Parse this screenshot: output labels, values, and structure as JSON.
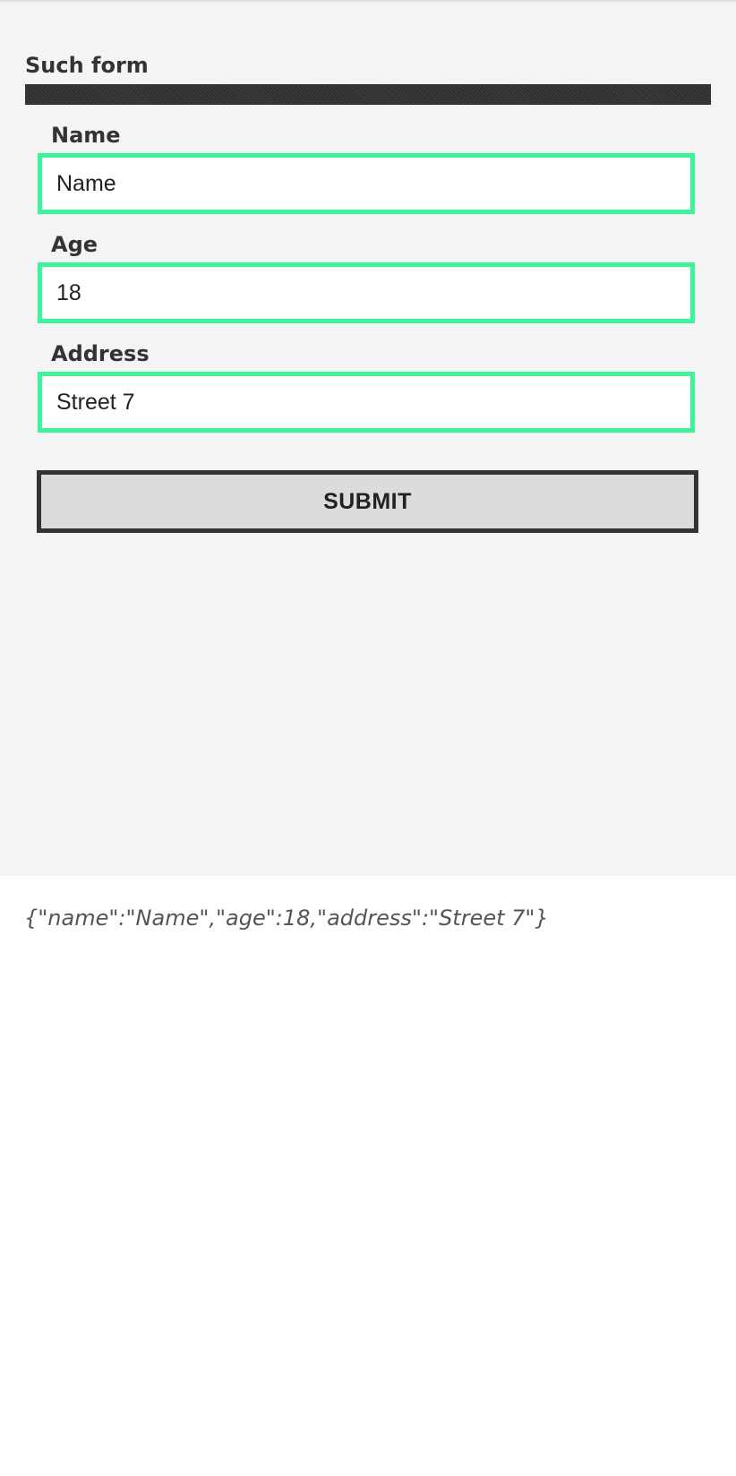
{
  "form": {
    "title": "Such form",
    "fields": [
      {
        "label": "Name",
        "value": "Name"
      },
      {
        "label": "Age",
        "value": "18"
      },
      {
        "label": "Address",
        "value": "Street 7"
      }
    ],
    "submit_label": "SUBMIT"
  },
  "output": {
    "json_text": "{\"name\":\"Name\",\"age\":18,\"address\":\"Street 7\"}"
  },
  "colors": {
    "panel_background": "#f4f4f4",
    "input_border": "#3ef49a",
    "title_bar": "#333333",
    "button_background": "#dcdcdc",
    "button_border": "#333333"
  }
}
